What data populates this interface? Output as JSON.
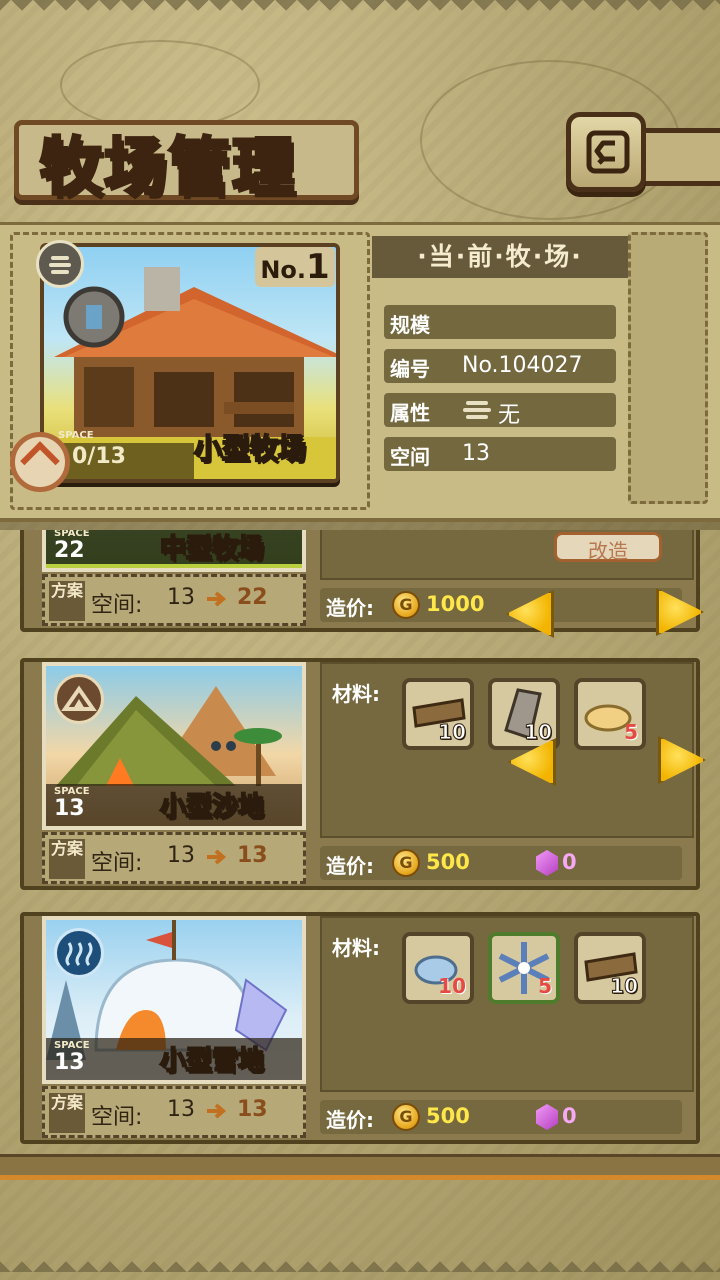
{
  "header": {
    "title": "牧场管理",
    "back_icon": "back-arrow-icon"
  },
  "current_ranch": {
    "section_title": "·当·前·牧·场·",
    "card": {
      "number_prefix": "No.",
      "number": "1",
      "name": "小型牧场",
      "space_label": "SPACE",
      "space_value": "0/13",
      "attribute_icon": "wind-icon",
      "type_icon": "ranch-icon"
    },
    "info": [
      {
        "key": "规模",
        "value": ""
      },
      {
        "key": "编号",
        "value": "No.104027"
      },
      {
        "key": "属性",
        "value": "无",
        "icon": "wind-icon"
      },
      {
        "key": "空间",
        "value": "13"
      }
    ]
  },
  "upgrades": [
    {
      "name": "中型牧场",
      "space_label": "SPACE",
      "space_value": "22",
      "plan_tag": "方案",
      "plan_text": "空间:",
      "space_from": "13",
      "space_to": "22",
      "upgrade_label": "改造",
      "cost_label": "造价:",
      "coin_symbol": "G",
      "coin_cost": "1000",
      "gem_cost": "",
      "materials": []
    },
    {
      "name": "小型沙地",
      "space_label": "SPACE",
      "space_value": "13",
      "plan_tag": "方案",
      "plan_text": "空间:",
      "space_from": "13",
      "space_to": "13",
      "materials_label": "材料:",
      "materials": [
        {
          "icon": "wood-plank-icon",
          "count": "10",
          "low": false
        },
        {
          "icon": "stone-slab-icon",
          "count": "10",
          "low": false
        },
        {
          "icon": "sand-pile-icon",
          "count": "5",
          "low": true
        }
      ],
      "cost_label": "造价:",
      "coin_symbol": "G",
      "coin_cost": "500",
      "gem_cost": "0",
      "type_icon": "mountain-icon"
    },
    {
      "name": "小型雪地",
      "space_label": "SPACE",
      "space_value": "13",
      "plan_tag": "方案",
      "plan_text": "空间:",
      "space_from": "13",
      "space_to": "13",
      "materials_label": "材料:",
      "materials": [
        {
          "icon": "ice-rock-icon",
          "count": "10",
          "low": true
        },
        {
          "icon": "snowflake-icon",
          "count": "5",
          "low": true
        },
        {
          "icon": "wood-plank-icon",
          "count": "10",
          "low": false
        }
      ],
      "cost_label": "造价:",
      "coin_symbol": "G",
      "coin_cost": "500",
      "gem_cost": "0",
      "type_icon": "water-icon"
    }
  ]
}
